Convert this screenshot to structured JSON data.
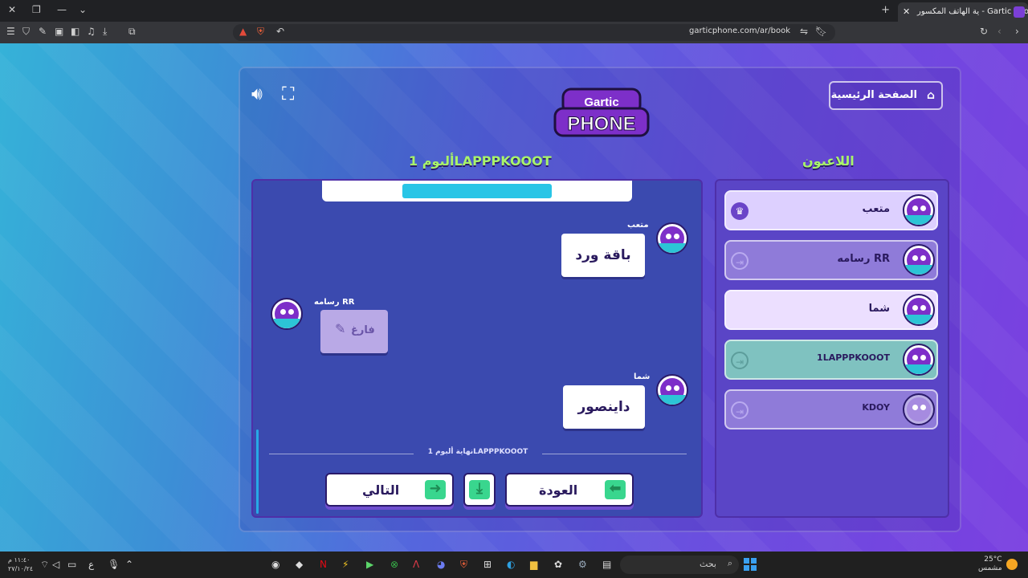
{
  "browser": {
    "tab_title": "ية الهاتف المكسور - Gartic Phone",
    "new_tab": "+",
    "url": "garticphone.com/ar/book"
  },
  "page": {
    "home_label": "الصفحة الرئيسية",
    "logo_top": "Gartic",
    "logo_bottom": "PHONE",
    "players_title": "اللاعبون",
    "album_title": "ألبوم 1LAPPPKOOOT",
    "album_end_text": "نهاية ألبوم 1LAPPPKOOOT",
    "entries": [
      {
        "player": "متعب",
        "content": "باقة ورد"
      },
      {
        "player": "رسامه RR",
        "content": "فارغ"
      },
      {
        "player": "شما",
        "content": "داينصور"
      }
    ],
    "buttons": {
      "next": "التالي",
      "back": "العودة"
    },
    "players": [
      {
        "name": "متعب",
        "status": "host"
      },
      {
        "name": "رسامه RR",
        "status": "left"
      },
      {
        "name": "شما",
        "status": "active"
      },
      {
        "name": "1LAPPPKOOOT",
        "status": "left-current"
      },
      {
        "name": "KDOY",
        "status": "left"
      }
    ],
    "colors": {
      "accent_green": "#a8f46a",
      "album_bg": "#3b4aaf",
      "arrow_green": "#39d68e",
      "highlight_teal": "#7fd8c8"
    }
  },
  "taskbar": {
    "search": "بحث",
    "temp": "25°C",
    "weather": "مشمس",
    "time": "١١:٤٠ م",
    "date": "٢٧/١٠/٢٤"
  }
}
